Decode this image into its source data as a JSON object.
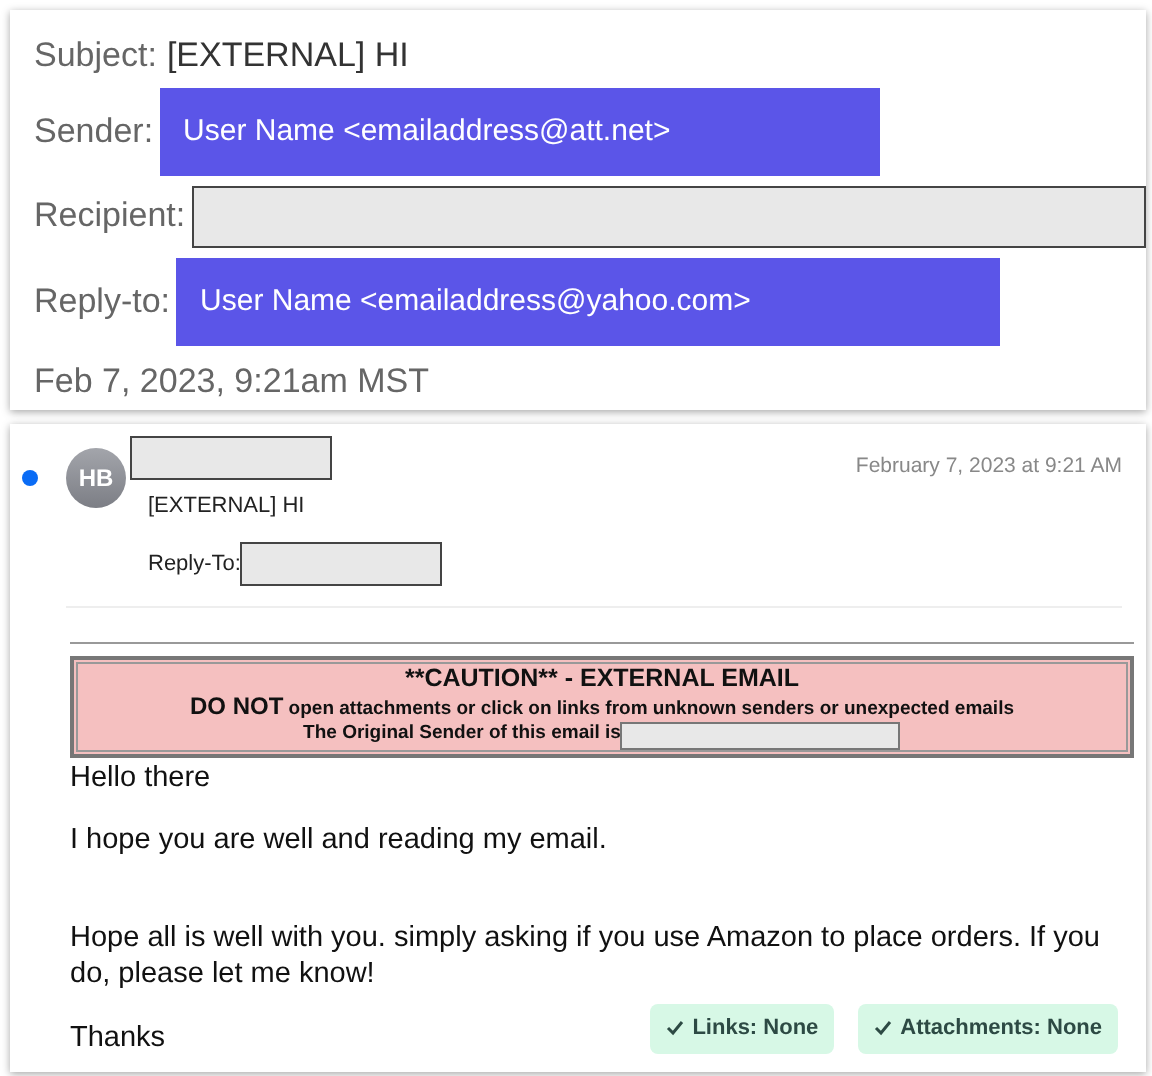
{
  "header_card": {
    "subject_label": "Subject:",
    "subject": "[EXTERNAL] HI",
    "sender_label": "Sender:",
    "sender": "User Name <emailaddress@att.net>",
    "recipient_label": "Recipient:",
    "reply_to_label": "Reply-to:",
    "reply_to": "User Name <emailaddress@yahoo.com>",
    "date": "Feb 7, 2023, 9:21am MST"
  },
  "message": {
    "unread": true,
    "avatar": "HB",
    "date": "February 7, 2023 at 9:21 AM",
    "subject": "[EXTERNAL] HI",
    "reply_to_label": "Reply-To:",
    "caution": {
      "title": "**CAUTION** - EXTERNAL EMAIL",
      "warning_lead": "DO NOT",
      "warning_text": "open attachments or click on links from unknown senders or unexpected emails",
      "sender_line": "The Original Sender of this email is"
    },
    "body": [
      {
        "kind": "line",
        "text": "Hello there"
      },
      {
        "kind": "line",
        "text": "I hope you are well and reading my email."
      },
      {
        "kind": "gap"
      },
      {
        "kind": "line",
        "text": "Hope all is well with you. simply asking if you use Amazon to place orders. If you do, please let me know!"
      },
      {
        "kind": "sign",
        "text": "Thanks"
      }
    ],
    "badges": [
      {
        "label": "Links: None"
      },
      {
        "label": "Attachments: None"
      }
    ]
  }
}
